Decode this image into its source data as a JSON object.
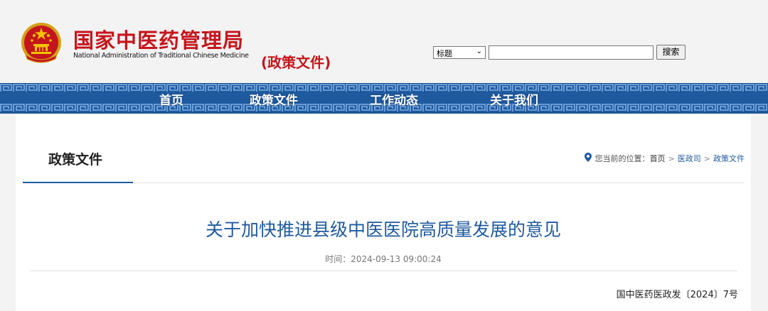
{
  "header": {
    "site_name_cn": "国家中医药管理局",
    "site_name_en": "National Administration of Traditional Chinese Medicine",
    "section_tag": "(政策文件)",
    "brand_color": "#c4161c",
    "emblem_icon": "national-emblem-icon"
  },
  "search": {
    "field_select_value": "标题",
    "input_value": "",
    "button_label": "搜索"
  },
  "nav": {
    "background_color": "#1f5a9e",
    "items": [
      {
        "label": "首页"
      },
      {
        "label": "政策文件"
      },
      {
        "label": "工作动态"
      },
      {
        "label": "关于我们"
      }
    ]
  },
  "panel": {
    "tab_label": "政策文件",
    "breadcrumb": {
      "pin_icon": "location-pin-icon",
      "prefix": "您当前的位置：",
      "items": [
        {
          "label": "首页"
        },
        {
          "label": "医政司"
        },
        {
          "label": "政策文件"
        }
      ],
      "separator": ">"
    }
  },
  "article": {
    "title": "关于加快推进县级中医医院高质量发展的意见",
    "time": "时间：2024-09-13 09:00:24",
    "doc_number": "国中医药医政发〔2024〕7号"
  }
}
